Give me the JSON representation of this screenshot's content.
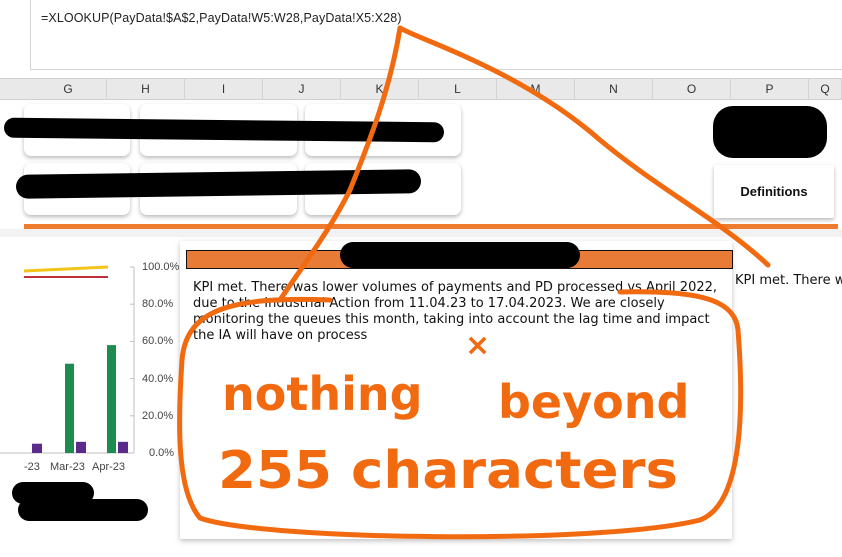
{
  "formula_bar": {
    "formula": "=XLOOKUP(PayData!$A$2,PayData!W5:W28,PayData!X5:X28)"
  },
  "columns": [
    "G",
    "H",
    "I",
    "J",
    "K",
    "L",
    "M",
    "N",
    "O",
    "P",
    "Q"
  ],
  "definitions_button": {
    "label": "Definitions"
  },
  "chart": {
    "y_ticks": [
      "100.0%",
      "80.0%",
      "60.0%",
      "40.0%",
      "20.0%",
      "0.0%"
    ],
    "x_ticks": [
      "-23",
      "Mar-23",
      "Apr-23"
    ]
  },
  "chart_data": {
    "type": "bar",
    "categories": [
      "-23",
      "Mar-23",
      "Apr-23"
    ],
    "series": [
      {
        "values": [
          0,
          48,
          58
        ]
      },
      {
        "values": [
          5,
          6,
          6
        ]
      }
    ],
    "ylim": [
      0,
      100
    ],
    "colors": [
      "#1e8c4e",
      "#5b2b8c",
      "#f2c318",
      "#c0303b"
    ]
  },
  "comment": {
    "body": "KPI met. There was lower volumes of payments and PD processed vs April 2022, due to the Industrial Action from 11.04.23 to 17.04.2023. We are closely monitoring the queues this month, taking into account the lag time and impact the IA will have on process",
    "overflow_cell_text": "KPI met. There w"
  },
  "annotation": {
    "line1": "nothing",
    "mark": "×",
    "line2": "beyond",
    "line3": "255 characters",
    "color": "#f26a10"
  }
}
